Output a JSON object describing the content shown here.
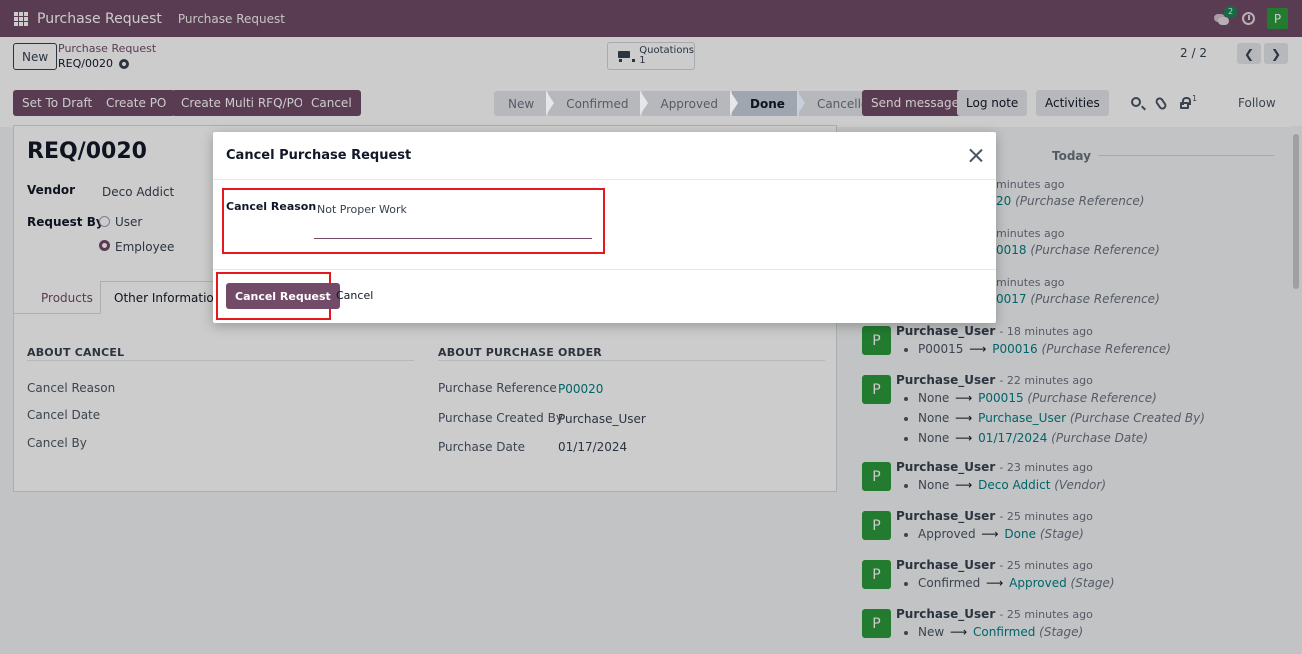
{
  "navbar": {
    "app_name": "Purchase Request",
    "menu_item": "Purchase Request",
    "chat_badge": "2",
    "user_initial": "P"
  },
  "control": {
    "new_label": "New",
    "breadcrumb_parent": "Purchase Request",
    "breadcrumb_current": "REQ/0020",
    "quotations_label": "Quotations",
    "quotations_count": "1",
    "pager": "2 / 2",
    "actions": [
      "Set To Draft",
      "Create PO",
      "Create Multi RFQ/PO",
      "Cancel"
    ],
    "stages": [
      "New",
      "Confirmed",
      "Approved",
      "Done",
      "Cancelled"
    ],
    "active_stage": "Done"
  },
  "chatter_tools": {
    "send_message": "Send message",
    "log_note": "Log note",
    "activities": "Activities",
    "followers": "1",
    "follow": "Follow"
  },
  "form": {
    "name": "REQ/0020",
    "vendor_label": "Vendor",
    "vendor_value": "Deco Addict",
    "request_by_label": "Request By",
    "request_by_options": [
      "User",
      "Employee"
    ],
    "tabs": [
      "Products",
      "Other Information"
    ],
    "about_cancel": {
      "title": "ABOUT CANCEL",
      "fields": [
        "Cancel Reason",
        "Cancel Date",
        "Cancel By"
      ]
    },
    "about_po": {
      "title": "ABOUT PURCHASE ORDER",
      "fields": [
        {
          "label": "Purchase Reference",
          "value": "P00020"
        },
        {
          "label": "Purchase Created By",
          "value": "Purchase_User"
        },
        {
          "label": "Purchase Date",
          "value": "01/17/2024"
        }
      ]
    }
  },
  "chatter": {
    "today": "Today",
    "partial": [
      {
        "time": "minutes ago",
        "new": "20",
        "field": "(Purchase Reference)"
      },
      {
        "time": "minutes ago",
        "new": "0018",
        "field": "(Purchase Reference)"
      },
      {
        "time": "minutes ago",
        "new": "0017",
        "field": "(Purchase Reference)"
      }
    ],
    "messages": [
      {
        "author": "Purchase_User",
        "time": "- 18 minutes ago",
        "lines": [
          {
            "old": "P00015",
            "new": "P00016",
            "field": "(Purchase Reference)"
          }
        ]
      },
      {
        "author": "Purchase_User",
        "time": "- 22 minutes ago",
        "lines": [
          {
            "old": "None",
            "new": "P00015",
            "field": "(Purchase Reference)"
          },
          {
            "old": "None",
            "new": "Purchase_User",
            "field": "(Purchase Created By)"
          },
          {
            "old": "None",
            "new": "01/17/2024",
            "field": "(Purchase Date)"
          }
        ]
      },
      {
        "author": "Purchase_User",
        "time": "- 23 minutes ago",
        "lines": [
          {
            "old": "None",
            "new": "Deco Addict",
            "field": "(Vendor)"
          }
        ]
      },
      {
        "author": "Purchase_User",
        "time": "- 25 minutes ago",
        "lines": [
          {
            "old": "Approved",
            "new": "Done",
            "field": "(Stage)"
          }
        ]
      },
      {
        "author": "Purchase_User",
        "time": "- 25 minutes ago",
        "lines": [
          {
            "old": "Confirmed",
            "new": "Approved",
            "field": "(Stage)"
          }
        ]
      },
      {
        "author": "Purchase_User",
        "time": "- 25 minutes ago",
        "lines": [
          {
            "old": "New",
            "new": "Confirmed",
            "field": "(Stage)"
          }
        ]
      }
    ]
  },
  "dialog": {
    "title": "Cancel Purchase Request",
    "reason_label": "Cancel Reason",
    "reason_value": "Not Proper Work",
    "confirm_label": "Cancel Request",
    "cancel_label": "Cancel"
  },
  "colors": {
    "brand": "#714b67",
    "link": "#017e84",
    "highlight": "#e3191e",
    "avatar": "#2c9a3c"
  }
}
